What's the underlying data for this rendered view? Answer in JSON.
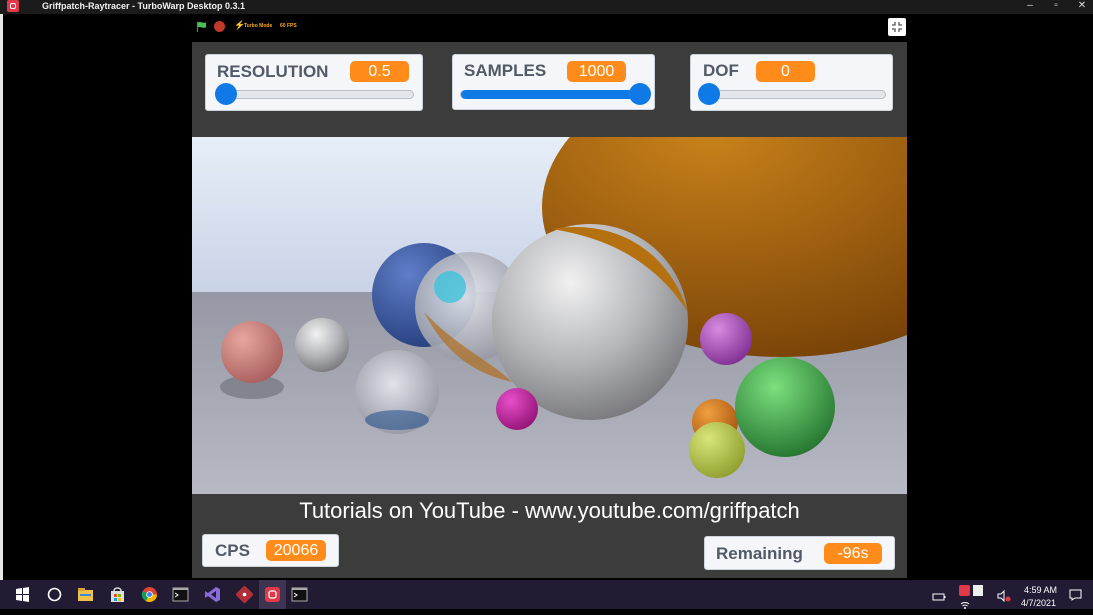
{
  "window": {
    "title": "Griffpatch-Raytracer - TurboWarp Desktop 0.3.1"
  },
  "controls": {
    "turbo_label": "Turbo Mode",
    "fps_label": "60 FPS"
  },
  "sliders": [
    {
      "label": "RESOLUTION",
      "value": "0.5",
      "fraction": 0.0
    },
    {
      "label": "SAMPLES",
      "value": "1000",
      "fraction": 1.0
    },
    {
      "label": "DOF",
      "value": "0",
      "fraction": 0.0
    }
  ],
  "stage": {
    "tutorial_text": "Tutorials on YouTube - www.youtube.com/griffpatch",
    "cps": {
      "label": "CPS",
      "value": "20066"
    },
    "remaining": {
      "label": "Remaining",
      "value": "-96s"
    }
  },
  "taskbar": {
    "icons": [
      "start-icon",
      "search-circle-icon",
      "file-explorer-icon",
      "store-icon",
      "chrome-icon",
      "terminal-icon",
      "visual-studio-icon",
      "git-icon",
      "turbowarp-icon",
      "terminal-icon"
    ],
    "clock": {
      "time": "4:59 AM",
      "date": "4/7/2021"
    }
  },
  "colors": {
    "accent_orange": "#ff8c1a",
    "slider_blue": "#0f7ae5",
    "taskbar": "#231a33"
  }
}
